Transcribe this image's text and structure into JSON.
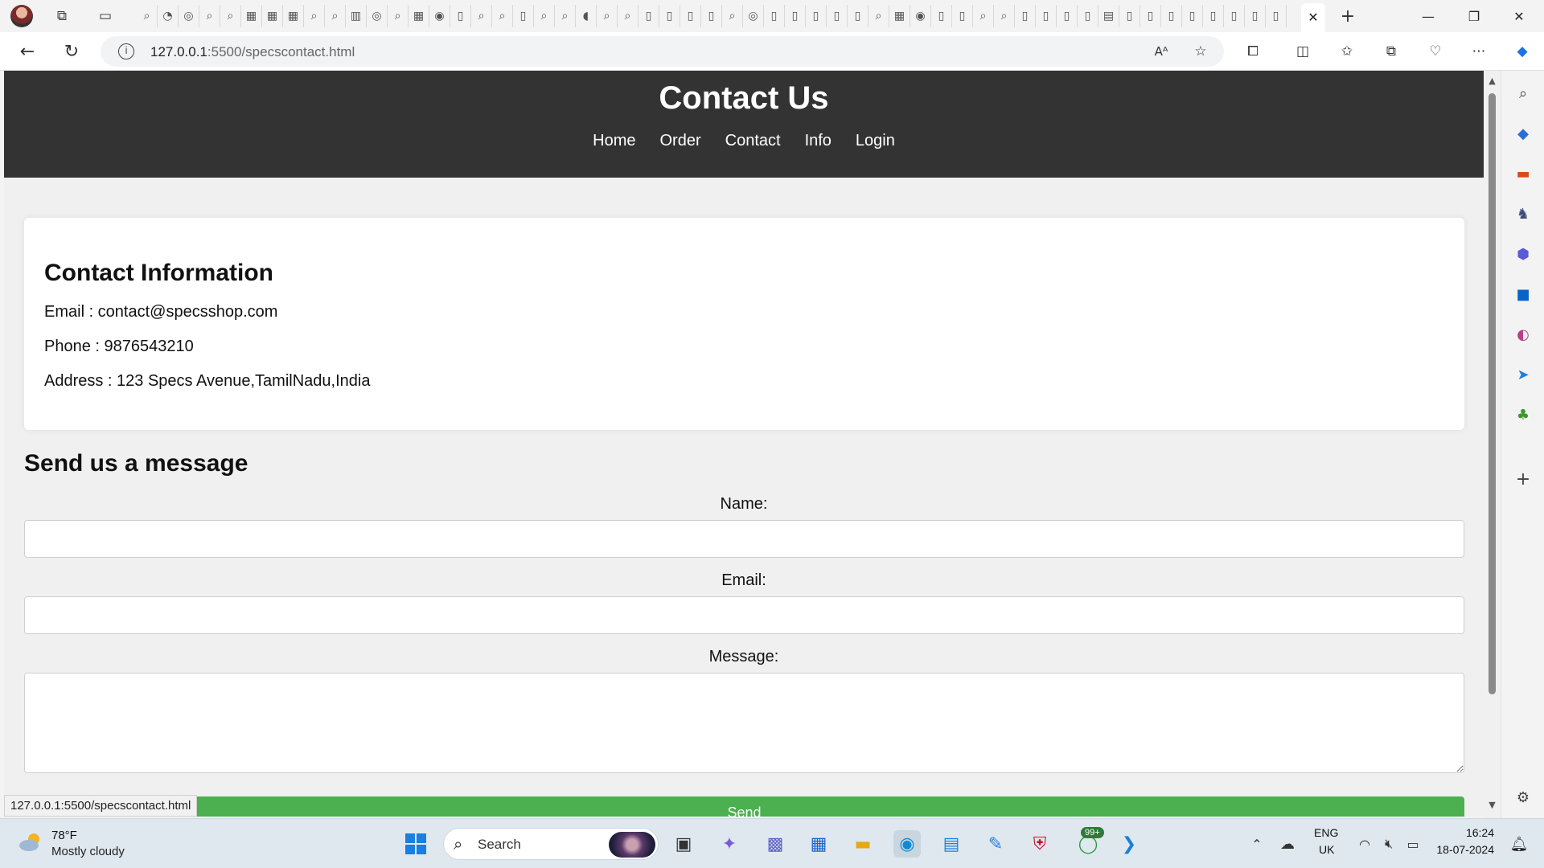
{
  "browser": {
    "url_host": "127.0.0.1",
    "url_path": ":5500/specscontact.html",
    "active_tab_close": "✕",
    "new_tab": "+",
    "window": {
      "minimize": "—",
      "maximize": "❐",
      "close": "✕"
    },
    "status_url": "127.0.0.1:5500/specscontact.html",
    "read_aloud": "Aᴬ"
  },
  "page": {
    "title": "Contact Us",
    "nav": [
      "Home",
      "Order",
      "Contact",
      "Info",
      "Login"
    ],
    "info": {
      "heading": "Contact Information",
      "email": "Email : contact@specsshop.com",
      "phone": "Phone : 9876543210",
      "address": "Address : 123 Specs Avenue,TamilNadu,India"
    },
    "form": {
      "heading": "Send us a message",
      "name_label": "Name:",
      "email_label": "Email:",
      "message_label": "Message:",
      "submit_label": "Send"
    }
  },
  "taskbar": {
    "weather_temp": "78°F",
    "weather_desc": "Mostly cloudy",
    "search_placeholder": "Search",
    "whatsapp_badge": "99+",
    "language": "ENG",
    "region": "UK",
    "time": "16:24",
    "date": "18-07-2024"
  },
  "colors": {
    "header_bg": "#333333",
    "send_button": "#4caf50",
    "page_bg": "#f0f0f0"
  }
}
